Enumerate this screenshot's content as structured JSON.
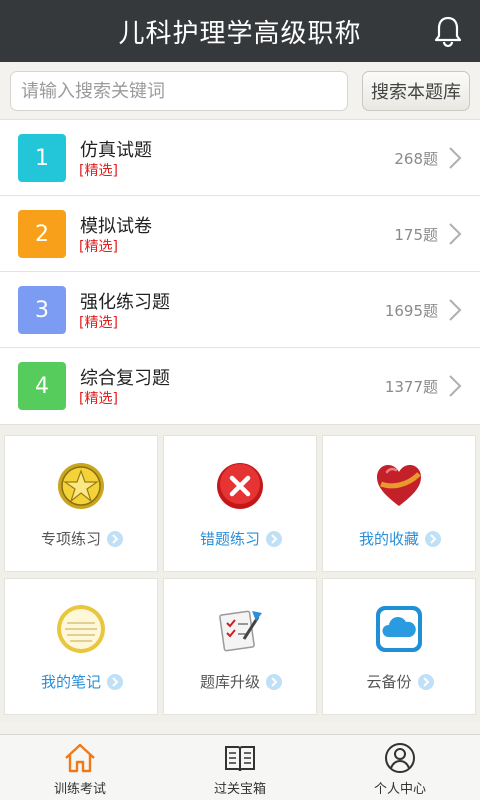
{
  "header": {
    "title": "儿科护理学高级职称",
    "bell_icon": "bell-icon"
  },
  "search": {
    "placeholder": "请输入搜索关键词",
    "button_label": "搜索本题库"
  },
  "list": {
    "items": [
      {
        "number": "1",
        "title": "仿真试题",
        "tag": "[精选]",
        "count": "268题",
        "color": "#22c6d8"
      },
      {
        "number": "2",
        "title": "模拟试卷",
        "tag": "[精选]",
        "count": "175题",
        "color": "#f8a01a"
      },
      {
        "number": "3",
        "title": "强化练习题",
        "tag": "[精选]",
        "count": "1695题",
        "color": "#7b9cf2"
      },
      {
        "number": "4",
        "title": "综合复习题",
        "tag": "[精选]",
        "count": "1377题",
        "color": "#56cc5c"
      }
    ]
  },
  "grid": {
    "tiles": [
      {
        "label": "专项练习",
        "icon": "star-badge-icon",
        "label_color": "gray"
      },
      {
        "label": "错题练习",
        "icon": "red-x-icon",
        "label_color": "blue"
      },
      {
        "label": "我的收藏",
        "icon": "heart-icon",
        "label_color": "blue"
      },
      {
        "label": "我的笔记",
        "icon": "notepad-icon",
        "label_color": "blue"
      },
      {
        "label": "题库升级",
        "icon": "checklist-upgrade-icon",
        "label_color": "gray"
      },
      {
        "label": "云备份",
        "icon": "cloud-icon",
        "label_color": "gray"
      }
    ]
  },
  "tabbar": {
    "tabs": [
      {
        "label": "训练考试",
        "icon": "home-icon",
        "active": true
      },
      {
        "label": "过关宝箱",
        "icon": "book-icon",
        "active": false
      },
      {
        "label": "个人中心",
        "icon": "user-icon",
        "active": false
      }
    ]
  }
}
